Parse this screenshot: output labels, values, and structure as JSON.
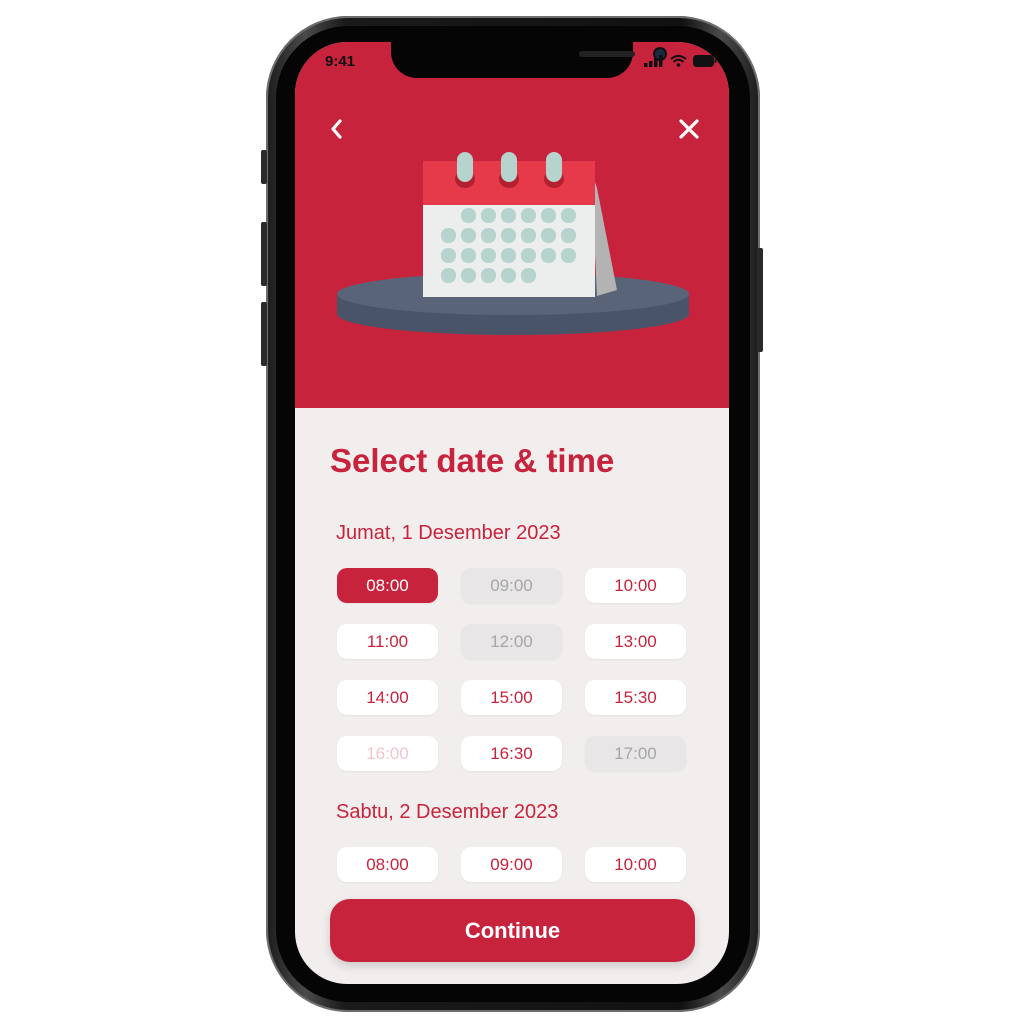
{
  "status_bar": {
    "time": "9:41"
  },
  "header": {
    "back_icon": "chevron-left-icon",
    "close_icon": "close-icon",
    "illustration": "calendar-illustration"
  },
  "title": "Select date & time",
  "days": [
    {
      "date_label": "Jumat, 1 Desember 2023",
      "slots": [
        {
          "time": "08:00",
          "state": "selected"
        },
        {
          "time": "09:00",
          "state": "disabled"
        },
        {
          "time": "10:00",
          "state": "available"
        },
        {
          "time": "11:00",
          "state": "available"
        },
        {
          "time": "12:00",
          "state": "disabled"
        },
        {
          "time": "13:00",
          "state": "available"
        },
        {
          "time": "14:00",
          "state": "available"
        },
        {
          "time": "15:00",
          "state": "available"
        },
        {
          "time": "15:30",
          "state": "available"
        },
        {
          "time": "16:00",
          "state": "faded"
        },
        {
          "time": "16:30",
          "state": "available"
        },
        {
          "time": "17:00",
          "state": "disabled"
        }
      ]
    },
    {
      "date_label": "Sabtu, 2 Desember 2023",
      "slots": [
        {
          "time": "08:00",
          "state": "available"
        },
        {
          "time": "09:00",
          "state": "available"
        },
        {
          "time": "10:00",
          "state": "available"
        }
      ]
    }
  ],
  "continue_label": "Continue",
  "colors": {
    "primary": "#c8233d",
    "background": "#f2eeee",
    "slot_bg": "#ffffff",
    "disabled_bg": "#e8e6e6",
    "disabled_text": "#a6a6a6"
  }
}
